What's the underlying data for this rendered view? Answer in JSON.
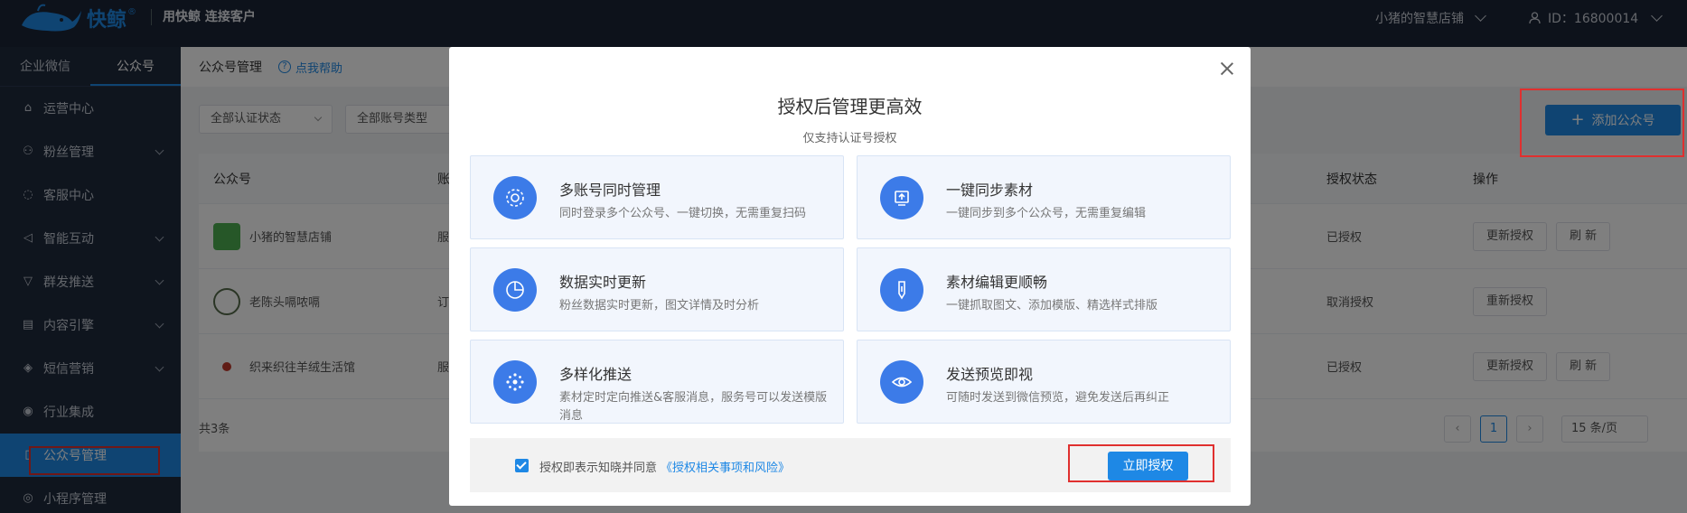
{
  "topbar": {
    "brand": "快鲸",
    "brand_reg": "®",
    "tagline": "用快鲸 连接客户",
    "shop_name": "小猪的智慧店铺",
    "user_id": "ID：16800014"
  },
  "sidebar": {
    "tabs": [
      {
        "label": "企业微信",
        "active": false
      },
      {
        "label": "公众号",
        "active": true
      }
    ],
    "items": [
      {
        "label": "运营中心",
        "icon": "home-icon",
        "has_arrow": false
      },
      {
        "label": "粉丝管理",
        "icon": "users-icon",
        "has_arrow": true
      },
      {
        "label": "客服中心",
        "icon": "chat-icon",
        "has_arrow": false
      },
      {
        "label": "智能互动",
        "icon": "megaphone-icon",
        "has_arrow": true
      },
      {
        "label": "群发推送",
        "icon": "funnel-icon",
        "has_arrow": true
      },
      {
        "label": "内容引擎",
        "icon": "document-icon",
        "has_arrow": true
      },
      {
        "label": "短信营销",
        "icon": "tag-icon",
        "has_arrow": true
      },
      {
        "label": "行业集成",
        "icon": "eye-icon",
        "has_arrow": false
      },
      {
        "label": "公众号管理",
        "icon": "book-icon",
        "has_arrow": false,
        "active": true
      },
      {
        "label": "小程序管理",
        "icon": "miniapp-icon",
        "has_arrow": false
      }
    ]
  },
  "page": {
    "title": "公众号管理",
    "help": "点我帮助",
    "filter_status": "全部认证状态",
    "filter_type": "全部账号类型",
    "add_button": "添加公众号"
  },
  "table": {
    "headers": {
      "name": "公众号",
      "type": "账",
      "status": "授权状态",
      "ops": "操作"
    },
    "rows": [
      {
        "name": "小猪的智慧店铺",
        "type": "服",
        "status": "已授权",
        "ops": [
          "更新授权",
          "刷 新"
        ]
      },
      {
        "name": "老陈头嗝哝嗝",
        "type": "订",
        "status": "取消授权",
        "ops": [
          "重新授权"
        ]
      },
      {
        "name": "织来织往羊绒生活馆",
        "type": "服",
        "status": "已授权",
        "ops": [
          "更新授权",
          "刷 新"
        ]
      }
    ],
    "total": "共3条",
    "current_page": "1",
    "page_size": "15 条/页"
  },
  "modal": {
    "title": "授权后管理更高效",
    "subtitle": "仅支持认证号授权",
    "features": [
      {
        "title": "多账号同时管理",
        "desc": "同时登录多个公众号、一键切换，无需重复扫码",
        "icon": "gear-icon"
      },
      {
        "title": "一键同步素材",
        "desc": "一键同步到多个公众号，无需重复编辑",
        "icon": "sync-icon"
      },
      {
        "title": "数据实时更新",
        "desc": "粉丝数据实时更新，图文详情及时分析",
        "icon": "pie-chart-icon"
      },
      {
        "title": "素材编辑更顺畅",
        "desc": "一键抓取图文、添加模版、精选样式排版",
        "icon": "pen-icon"
      },
      {
        "title": "多样化推送",
        "desc": "素材定时定向推送&客服消息，服务号可以发送模版消息",
        "icon": "network-icon"
      },
      {
        "title": "发送预览即视",
        "desc": "可随时发送到微信预览，避免发送后再纠正",
        "icon": "eye-icon"
      }
    ],
    "agree_text": "授权即表示知晓并同意",
    "agree_link": "《授权相关事项和风险》",
    "authorize_button": "立即授权",
    "checked": true
  },
  "colors": {
    "accent": "#1e88e5",
    "highlight": "#e0302f",
    "topbar": "#1b2536",
    "sidebar": "#1f2a3d"
  }
}
